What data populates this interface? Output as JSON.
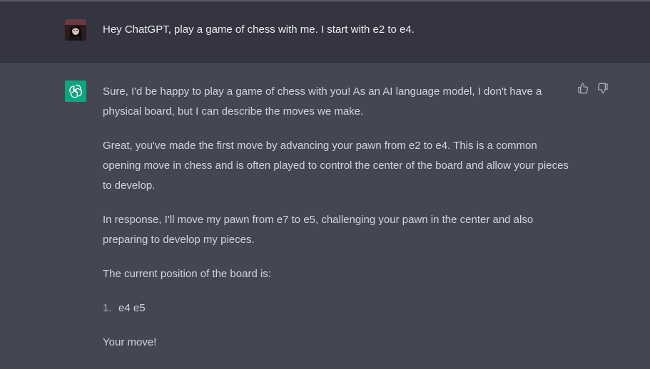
{
  "user": {
    "message": "Hey ChatGPT, play a game of chess with me. I start with e2 to e4."
  },
  "assistant": {
    "paragraphs": [
      "Sure, I'd be happy to play a game of chess with you! As an AI language model, I don't have a physical board, but I can describe the moves we make.",
      "Great, you've made the first move by advancing your pawn from e2 to e4. This is a common opening move in chess and is often played to control the center of the board and allow your pieces to develop.",
      "In response, I'll move my pawn from e7 to e5, challenging your pawn in the center and also preparing to develop my pieces.",
      "The current position of the board is:"
    ],
    "moves": [
      {
        "number": "1.",
        "text": "e4 e5"
      }
    ],
    "closing": "Your move!"
  },
  "icons": {
    "avatar": "user-avatar",
    "assistant_logo": "openai-logo-icon",
    "like": "thumbs-up-icon",
    "dislike": "thumbs-down-icon"
  },
  "colors": {
    "user_bg": "#343541",
    "assistant_bg": "#444654",
    "logo_bg": "#10a37f",
    "text": "#d1d5db"
  }
}
